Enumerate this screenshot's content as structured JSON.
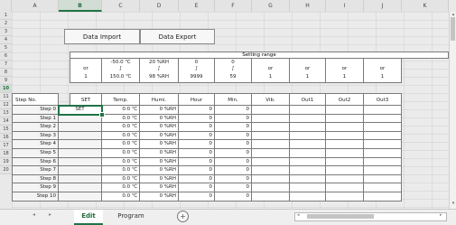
{
  "columns": [
    "A",
    "B",
    "C",
    "D",
    "E",
    "F",
    "G",
    "H",
    "I",
    "J",
    "K"
  ],
  "rows": [
    "1",
    "2",
    "3",
    "4",
    "5",
    "6",
    "7",
    "8",
    "9",
    "10",
    "11",
    "12",
    "13",
    "14",
    "15",
    "16",
    "17",
    "18",
    "19",
    "20"
  ],
  "buttons": {
    "import": "Data Import",
    "export": "Data Export"
  },
  "setting_range": {
    "title": "Setting range",
    "top": [
      "",
      "-50.0 ℃",
      "20 %RH",
      "0",
      "0",
      "",
      "",
      "",
      ""
    ],
    "mid": [
      "or",
      "∫",
      "∫",
      "∫",
      "∫",
      "or",
      "or",
      "or",
      "or"
    ],
    "bottom": [
      "1",
      "150.0 ℃",
      "98 %RH",
      "9999",
      "59",
      "1",
      "1",
      "1",
      "1"
    ]
  },
  "table": {
    "step_header": "Step  No.",
    "headers": [
      "SET",
      "Temp.",
      "Humi.",
      "Hour",
      "Min.",
      "Vib.",
      "Out1",
      "Out2",
      "Out3"
    ],
    "rows": [
      {
        "step": "Step 0",
        "set": "SET",
        "temp": "0.0 ℃",
        "humi": "0 %RH",
        "hour": "0",
        "min": "0"
      },
      {
        "step": "Step 1",
        "set": "",
        "temp": "0.0 ℃",
        "humi": "0 %RH",
        "hour": "0",
        "min": "0"
      },
      {
        "step": "Step 2",
        "set": "",
        "temp": "0.0 ℃",
        "humi": "0 %RH",
        "hour": "0",
        "min": "0"
      },
      {
        "step": "Step 3",
        "set": "",
        "temp": "0.0 ℃",
        "humi": "0 %RH",
        "hour": "0",
        "min": "0"
      },
      {
        "step": "Step 4",
        "set": "",
        "temp": "0.0 ℃",
        "humi": "0 %RH",
        "hour": "0",
        "min": "0"
      },
      {
        "step": "Step 5",
        "set": "",
        "temp": "0.0 ℃",
        "humi": "0 %RH",
        "hour": "0",
        "min": "0"
      },
      {
        "step": "Step 6",
        "set": "",
        "temp": "0.0 ℃",
        "humi": "0 %RH",
        "hour": "0",
        "min": "0"
      },
      {
        "step": "Step 7",
        "set": "",
        "temp": "0.0 ℃",
        "humi": "0 %RH",
        "hour": "0",
        "min": "0"
      },
      {
        "step": "Step 8",
        "set": "",
        "temp": "0.0 ℃",
        "humi": "0 %RH",
        "hour": "0",
        "min": "0"
      },
      {
        "step": "Step 9",
        "set": "",
        "temp": "0.0 ℃",
        "humi": "0 %RH",
        "hour": "0",
        "min": "0"
      },
      {
        "step": "Step 10",
        "set": "",
        "temp": "0.0 ℃",
        "humi": "0 %RH",
        "hour": "0",
        "min": "0"
      }
    ]
  },
  "tabs": [
    {
      "label": "Edit",
      "active": true
    },
    {
      "label": "Program",
      "active": false
    }
  ],
  "add_sheet_symbol": "+",
  "nav": {
    "prev": "◂",
    "next": "▸"
  },
  "scroll": {
    "up": "▴",
    "down": "▾",
    "left": "◂",
    "right": "▸"
  },
  "colors": {
    "selection": "#217346"
  }
}
